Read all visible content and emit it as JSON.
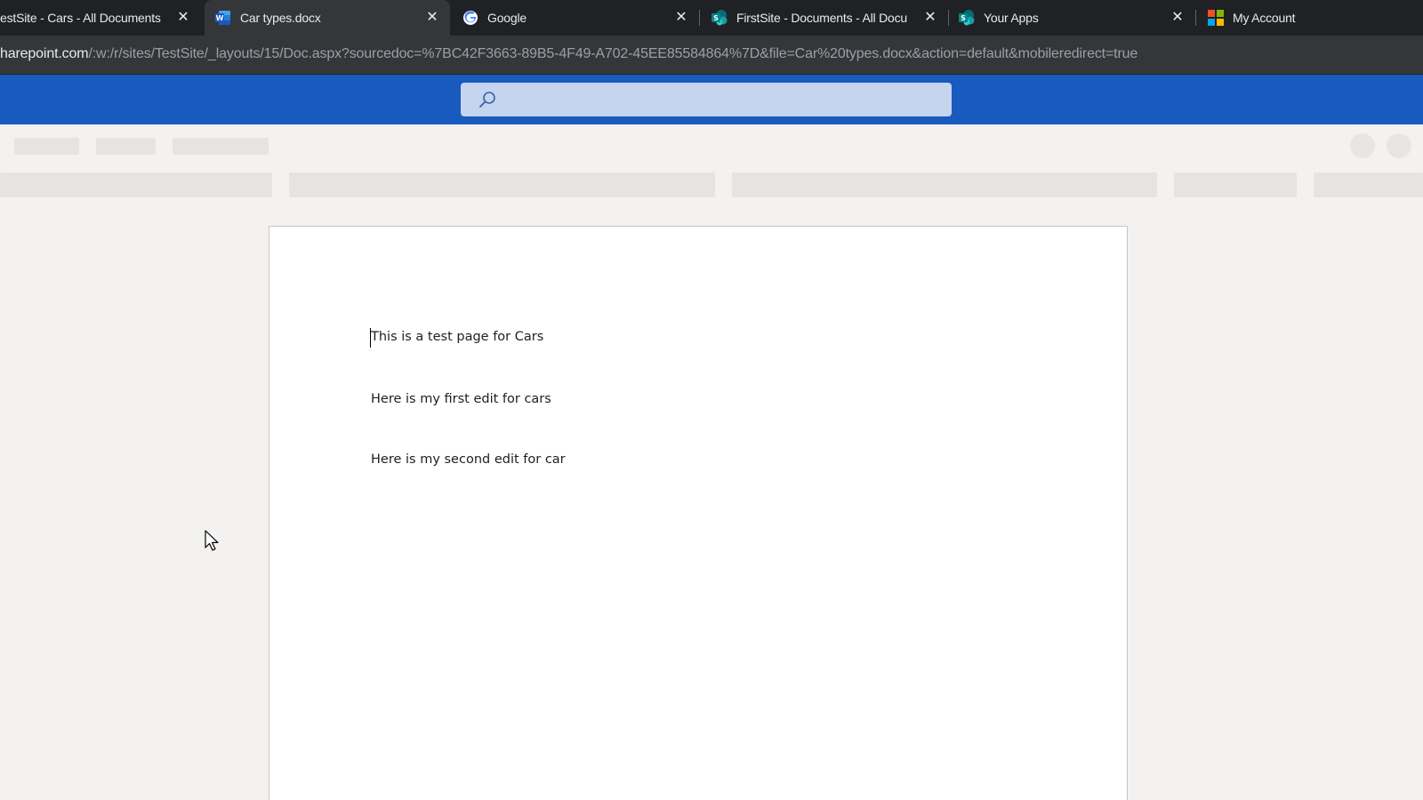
{
  "browser": {
    "tabs": [
      {
        "title": "estSite - Cars - All Documents",
        "icon": "sharepoint-icon",
        "active": false
      },
      {
        "title": "Car types.docx",
        "icon": "word-icon",
        "active": true
      },
      {
        "title": "Google",
        "icon": "google-icon",
        "active": false
      },
      {
        "title": "FirstSite - Documents - All Docu",
        "icon": "sharepoint-icon",
        "active": false
      },
      {
        "title": "Your Apps",
        "icon": "sharepoint-icon",
        "active": false
      },
      {
        "title": "My Account",
        "icon": "microsoft-icon",
        "active": false
      }
    ],
    "close_glyph": "✕",
    "url_host": "harepoint.com",
    "url_path": "/:w:/r/sites/TestSite/_layouts/15/Doc.aspx?sourcedoc=%7BC42F3663-89B5-4F49-A702-45EE85584864%7D&file=Car%20types.docx&action=default&mobileredirect=true"
  },
  "office": {
    "brand_color": "#185abd",
    "search_icon": "search-icon"
  },
  "document": {
    "paragraphs": [
      "This is a test page for Cars",
      "Here is my first edit for cars",
      "Here is my second edit for car"
    ]
  }
}
